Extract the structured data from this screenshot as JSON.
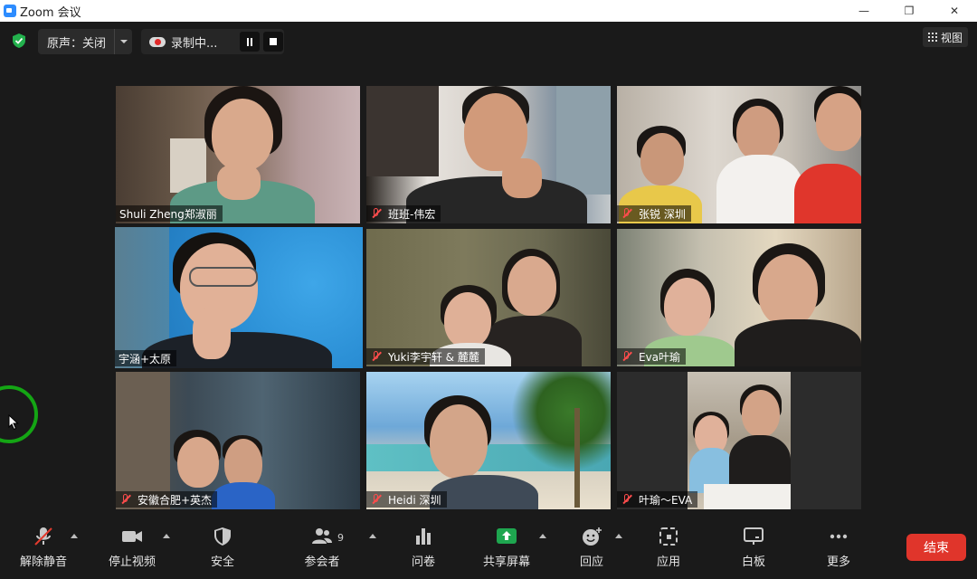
{
  "window": {
    "title": "Zoom 会议",
    "minimize": "—",
    "restore": "❐",
    "close": "✕"
  },
  "topbar": {
    "audio_label": "原声：关闭",
    "recording_label": "录制中...",
    "view_label": "视图"
  },
  "participants": [
    {
      "name": "Shuli Zheng郑淑丽",
      "muted": false
    },
    {
      "name": "班班-伟宏",
      "muted": true
    },
    {
      "name": "张锐 深圳",
      "muted": true
    },
    {
      "name": "宇涵+太原",
      "muted": false,
      "active_speaker": true
    },
    {
      "name": "Yuki李宇轩 & 麓麓",
      "muted": true
    },
    {
      "name": "Eva叶瑜",
      "muted": true
    },
    {
      "name": "安徽合肥+英杰",
      "muted": true
    },
    {
      "name": "Heidi 深圳",
      "muted": true
    },
    {
      "name": "叶瑜～EVA",
      "muted": true
    }
  ],
  "toolbar": {
    "unmute": "解除静音",
    "stop_video": "停止视频",
    "security": "安全",
    "participants": "参会者",
    "participants_count": "9",
    "polls": "问卷",
    "share_screen": "共享屏幕",
    "reactions": "回应",
    "apps": "应用",
    "whiteboard": "白板",
    "more": "更多",
    "end": "结束"
  },
  "colors": {
    "accent_green": "#1ea64f",
    "active_speaker": "#d7e83a",
    "end_red": "#e0352b",
    "mute_red": "#ff4c4c"
  }
}
